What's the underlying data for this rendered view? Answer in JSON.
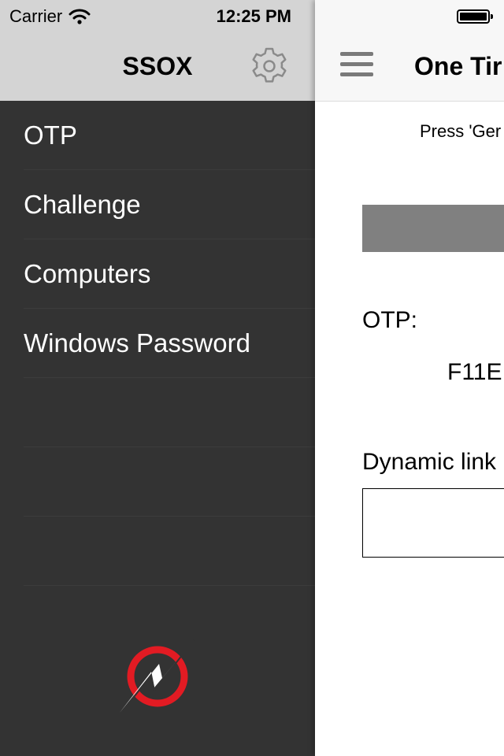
{
  "status_bar": {
    "carrier": "Carrier",
    "time": "12:25 PM"
  },
  "drawer": {
    "title": "SSOX",
    "header_icon": "gear-icon",
    "menu_items": [
      {
        "label": "OTP"
      },
      {
        "label": "Challenge"
      },
      {
        "label": "Computers"
      },
      {
        "label": "Windows Password"
      }
    ],
    "logo_icon": "ssox-logo"
  },
  "content": {
    "nav_icon": "hamburger-menu-icon",
    "title": "One Tir",
    "instruction": "Press 'Ger",
    "otp_label": "OTP:",
    "otp_value": "F11E",
    "dynamic_link_label": "Dynamic link"
  },
  "colors": {
    "drawer_bg": "#333333",
    "drawer_header_bg": "#d4d4d4",
    "button_bg": "#808080",
    "logo_red": "#e21b23"
  }
}
